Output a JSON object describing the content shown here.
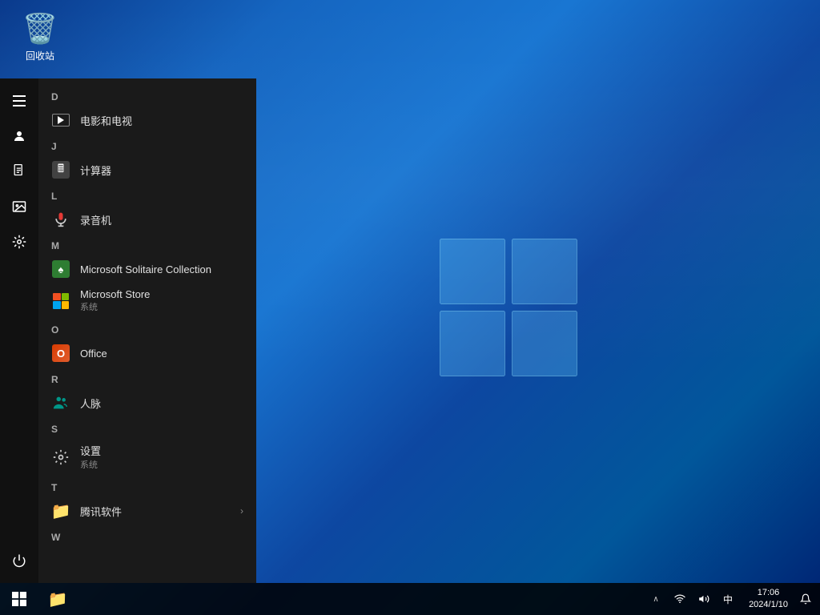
{
  "desktop": {
    "recycle_bin_label": "回收站"
  },
  "taskbar": {
    "start_button_label": "Start",
    "pinned_file_explorer_label": "File Explorer",
    "time": "17:06",
    "date": "2024/1/10",
    "language": "中",
    "notification_label": "Notifications",
    "tray": {
      "show_hidden": "^",
      "network": "🌐",
      "volume": "🔊",
      "ime": "中"
    }
  },
  "start_menu": {
    "hamburger": "☰",
    "sections": [
      {
        "id": "D",
        "label": "D",
        "items": [
          {
            "id": "movies-tv",
            "name": "电影和电视",
            "icon_type": "movies",
            "subtext": ""
          }
        ]
      },
      {
        "id": "J",
        "label": "J",
        "items": [
          {
            "id": "calculator",
            "name": "计算器",
            "icon_type": "calculator",
            "subtext": ""
          }
        ]
      },
      {
        "id": "L",
        "label": "L",
        "items": [
          {
            "id": "recorder",
            "name": "录音机",
            "icon_type": "recorder",
            "subtext": ""
          }
        ]
      },
      {
        "id": "M",
        "label": "M",
        "items": [
          {
            "id": "solitaire",
            "name": "Microsoft Solitaire Collection",
            "icon_type": "solitaire",
            "subtext": ""
          },
          {
            "id": "ms-store",
            "name": "Microsoft Store",
            "icon_type": "ms-store",
            "subtext": "系统"
          }
        ]
      },
      {
        "id": "O",
        "label": "O",
        "items": [
          {
            "id": "office",
            "name": "Office",
            "icon_type": "office",
            "subtext": ""
          }
        ]
      },
      {
        "id": "R",
        "label": "R",
        "items": [
          {
            "id": "people",
            "name": "人脉",
            "icon_type": "people",
            "subtext": ""
          }
        ]
      },
      {
        "id": "S",
        "label": "S",
        "items": [
          {
            "id": "settings",
            "name": "设置",
            "icon_type": "settings",
            "subtext": "系统"
          }
        ]
      },
      {
        "id": "T",
        "label": "T",
        "items": [
          {
            "id": "tencent",
            "name": "腾讯软件",
            "icon_type": "folder",
            "subtext": "",
            "has_arrow": true
          }
        ]
      },
      {
        "id": "W",
        "label": "W",
        "items": []
      }
    ],
    "sidebar_icons": [
      {
        "id": "user",
        "icon": "👤"
      },
      {
        "id": "document",
        "icon": "📄"
      },
      {
        "id": "photos",
        "icon": "🖼"
      },
      {
        "id": "settings",
        "icon": "⚙"
      },
      {
        "id": "power",
        "icon": "⏻"
      }
    ]
  }
}
